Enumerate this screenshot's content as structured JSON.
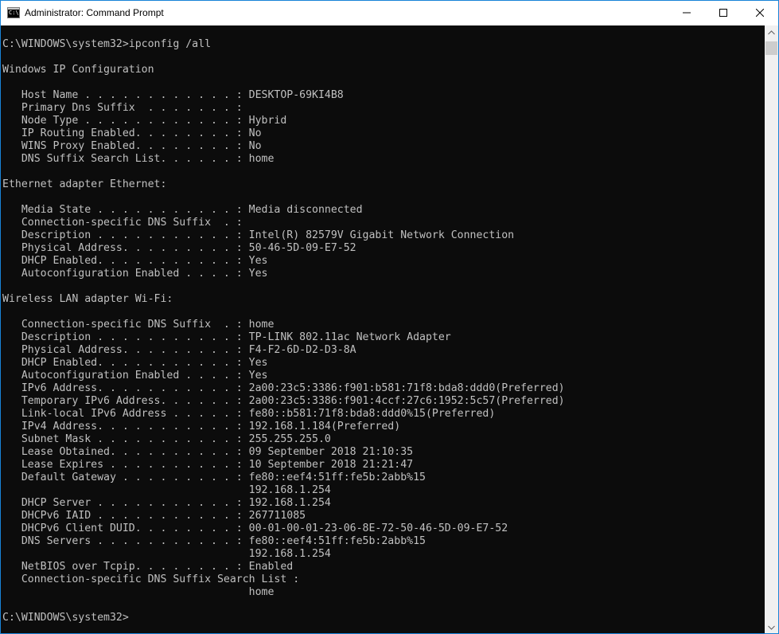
{
  "window": {
    "title": "Administrator: Command Prompt",
    "icon": "cmd-icon",
    "icon_text": "C:\\",
    "controls": [
      "minimize-icon",
      "maximize-icon",
      "close-icon"
    ]
  },
  "console": {
    "background": "#0c0c0c",
    "foreground": "#c0c0c0",
    "lines": [
      "C:\\WINDOWS\\system32>ipconfig /all",
      "",
      "Windows IP Configuration",
      "",
      "   Host Name . . . . . . . . . . . . : DESKTOP-69KI4B8",
      "   Primary Dns Suffix  . . . . . . . :",
      "   Node Type . . . . . . . . . . . . : Hybrid",
      "   IP Routing Enabled. . . . . . . . : No",
      "   WINS Proxy Enabled. . . . . . . . : No",
      "   DNS Suffix Search List. . . . . . : home",
      "",
      "Ethernet adapter Ethernet:",
      "",
      "   Media State . . . . . . . . . . . : Media disconnected",
      "   Connection-specific DNS Suffix  . :",
      "   Description . . . . . . . . . . . : Intel(R) 82579V Gigabit Network Connection",
      "   Physical Address. . . . . . . . . : 50-46-5D-09-E7-52",
      "   DHCP Enabled. . . . . . . . . . . : Yes",
      "   Autoconfiguration Enabled . . . . : Yes",
      "",
      "Wireless LAN adapter Wi-Fi:",
      "",
      "   Connection-specific DNS Suffix  . : home",
      "   Description . . . . . . . . . . . : TP-LINK 802.11ac Network Adapter",
      "   Physical Address. . . . . . . . . : F4-F2-6D-D2-D3-8A",
      "   DHCP Enabled. . . . . . . . . . . : Yes",
      "   Autoconfiguration Enabled . . . . : Yes",
      "   IPv6 Address. . . . . . . . . . . : 2a00:23c5:3386:f901:b581:71f8:bda8:ddd0(Preferred)",
      "   Temporary IPv6 Address. . . . . . : 2a00:23c5:3386:f901:4ccf:27c6:1952:5c57(Preferred)",
      "   Link-local IPv6 Address . . . . . : fe80::b581:71f8:bda8:ddd0%15(Preferred)",
      "   IPv4 Address. . . . . . . . . . . : 192.168.1.184(Preferred)",
      "   Subnet Mask . . . . . . . . . . . : 255.255.255.0",
      "   Lease Obtained. . . . . . . . . . : 09 September 2018 21:10:35",
      "   Lease Expires . . . . . . . . . . : 10 September 2018 21:21:47",
      "   Default Gateway . . . . . . . . . : fe80::eef4:51ff:fe5b:2abb%15",
      "                                       192.168.1.254",
      "   DHCP Server . . . . . . . . . . . : 192.168.1.254",
      "   DHCPv6 IAID . . . . . . . . . . . : 267711085",
      "   DHCPv6 Client DUID. . . . . . . . : 00-01-00-01-23-06-8E-72-50-46-5D-09-E7-52",
      "   DNS Servers . . . . . . . . . . . : fe80::eef4:51ff:fe5b:2abb%15",
      "                                       192.168.1.254",
      "   NetBIOS over Tcpip. . . . . . . . : Enabled",
      "   Connection-specific DNS Suffix Search List :",
      "                                       home",
      "",
      "C:\\WINDOWS\\system32>"
    ]
  },
  "scrollbar": {
    "up_icon": "scroll-up-arrow-icon",
    "down_icon": "scroll-down-arrow-icon"
  }
}
